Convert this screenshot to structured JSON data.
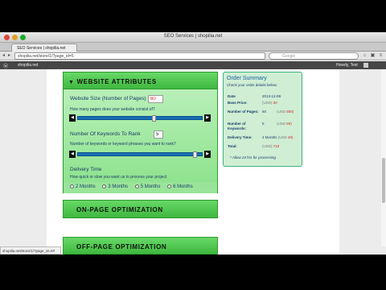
{
  "window": {
    "title": "SEO Services | shopilia.net"
  },
  "tab": {
    "label": "SEO Services | shopilia.net"
  },
  "toolbar": {
    "address": "shopilia.net/store/1/?page_id=5",
    "search_placeholder": "Google"
  },
  "adminbar": {
    "site": "shopilia.net",
    "greeting": "Howdy, Test"
  },
  "panel": {
    "website_attributes": "WEBSITE ATTRIBUTES",
    "size_label": "Website Size (Number of Pages)",
    "size_value": "60",
    "size_help": "How many pages does your website consist of?",
    "size_slider_fraction": 0.62,
    "keywords_label": "Number Of Keywords To Rank",
    "keywords_value": "5",
    "keywords_help": "Number of keywords or keyword phrases you want to rank?",
    "keywords_slider_fraction": 0.96,
    "delivery_label": "Delivery Time",
    "delivery_help": "How quick or slow you want us to process your project",
    "delivery_options": [
      "2 Months",
      "3 Months",
      "5 Months",
      "6 Months"
    ],
    "delivery_selected": 0,
    "on_page": "ON-PAGE OPTIMIZATION",
    "off_page": "OFF-PAGE OPTIMIZATION"
  },
  "summary": {
    "title": "Order Summary",
    "subtitle": "Check your order details below.",
    "rows": [
      {
        "label": "Date",
        "value": "2013-12-09"
      },
      {
        "label": "Base Price:",
        "usd": "(USD)",
        "amount": "20"
      },
      {
        "label": "Number of Pages:",
        "count": "60",
        "usd": "(USD",
        "amount": "600)"
      },
      {
        "label": "Number of Keywords:",
        "count": "5",
        "usd": "(USD",
        "amount": "50)"
      },
      {
        "label": "Delivery Time:",
        "count": "2 Months",
        "usd": "(USD",
        "amount": "40)"
      },
      {
        "label": "Total:",
        "usd": "(USD)",
        "amount": "710"
      }
    ],
    "note": "* Allow 24 hrs for processing"
  },
  "status": {
    "url": "shopilia.net/store/1/?page_id=5#"
  },
  "colors": {
    "green": "#4cc84c",
    "summary_bg": "#cfeed4",
    "slider": "#1a6fb5",
    "price": "#d21f1f"
  }
}
